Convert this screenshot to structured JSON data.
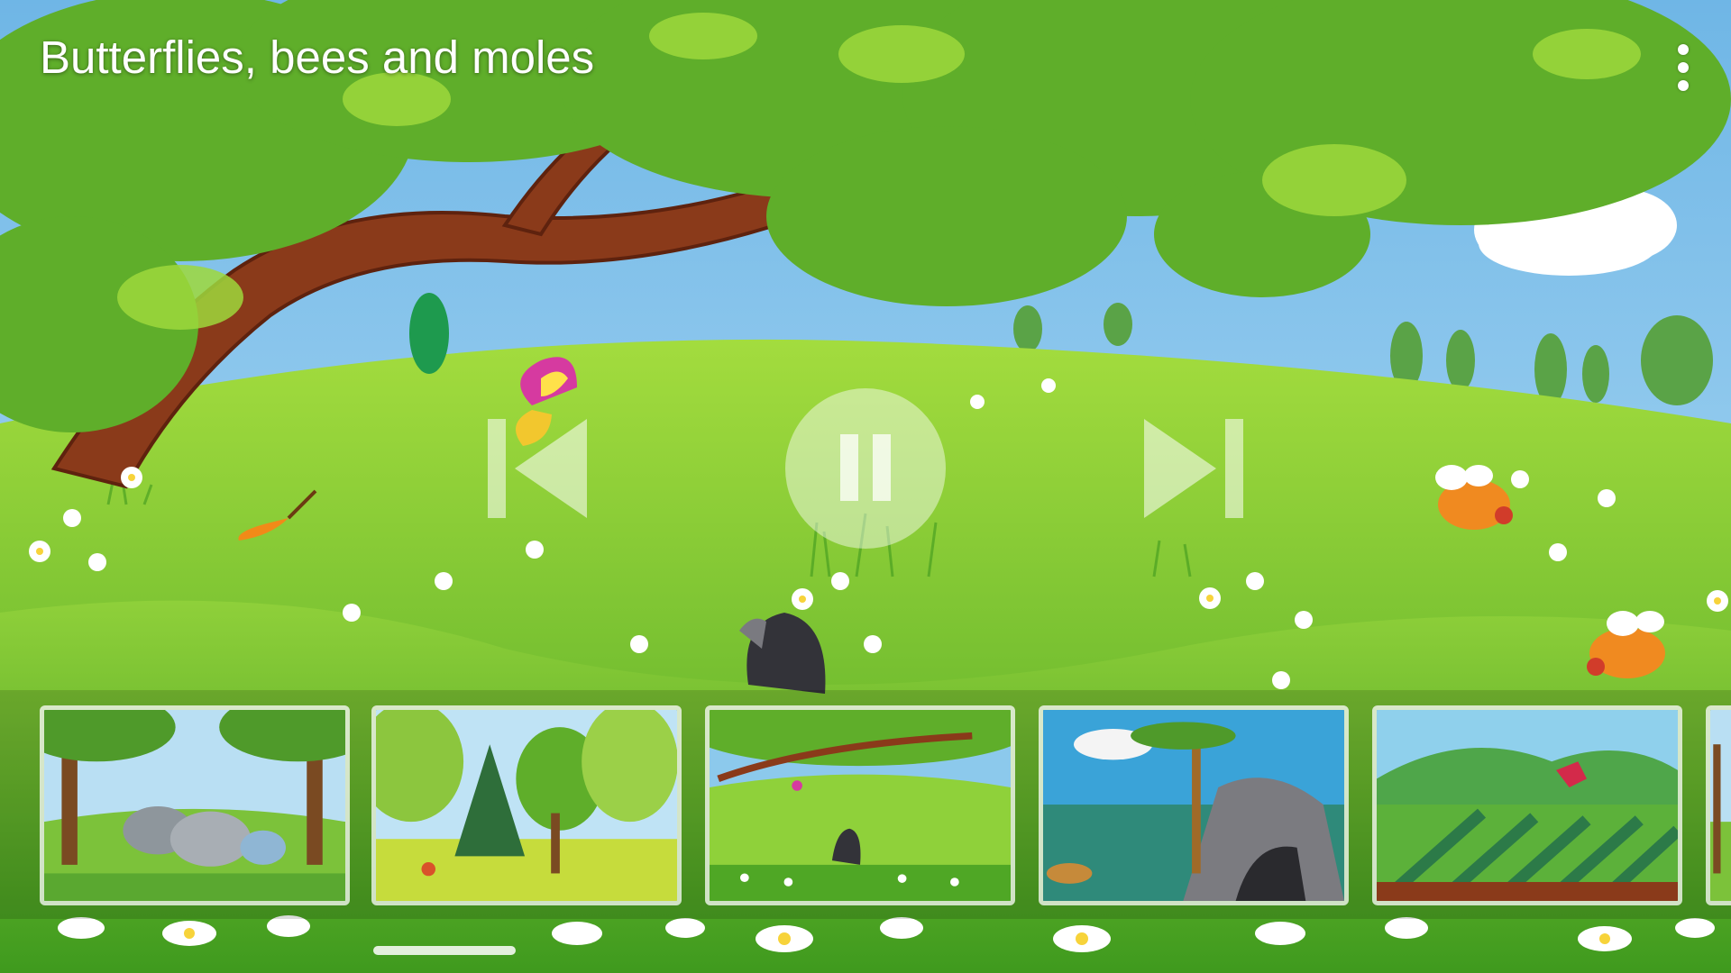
{
  "header": {
    "title": "Butterflies, bees and moles",
    "menu_icon": "more-vert-icon"
  },
  "player": {
    "state": "playing",
    "prev_icon": "skip-previous-icon",
    "pause_icon": "pause-icon",
    "next_icon": "skip-next-icon"
  },
  "playlist": {
    "items": [
      {
        "scene": "elephants-in-jungle"
      },
      {
        "scene": "forest-trees"
      },
      {
        "scene": "meadow-mole-butterflies",
        "current": true
      },
      {
        "scene": "cave-palm-flamingo"
      },
      {
        "scene": "field-red-dragon"
      },
      {
        "scene": "partial-next"
      }
    ]
  },
  "colors": {
    "sky": "#7ec2ea",
    "grass_light": "#8fd13a",
    "grass_dark": "#3d9a1c",
    "tree_trunk": "#8a3a1a",
    "leaf": "#5fae2a",
    "control_tint": "#ffffff"
  }
}
